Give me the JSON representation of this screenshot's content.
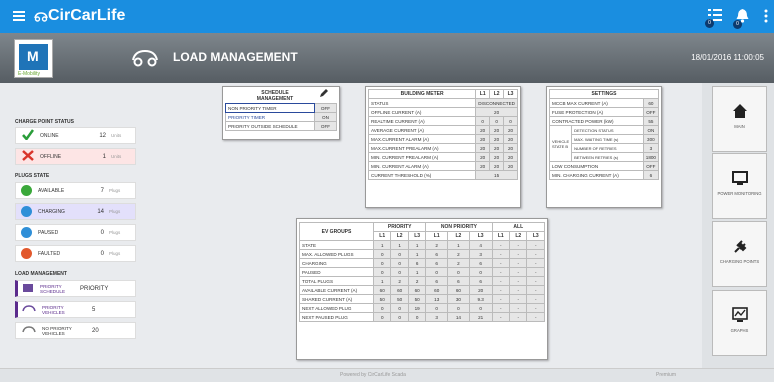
{
  "app": {
    "name": "CirCarLife",
    "notif_count_1": "0",
    "notif_count_2": "0"
  },
  "header": {
    "title": "LOAD MANAGEMENT",
    "datetime": "18/01/2016 11:00:05"
  },
  "logo": {
    "letters": "M",
    "caption": "E-Mobility"
  },
  "charge_point_status": {
    "title": "CHARGE POINT STATUS",
    "rows": [
      {
        "label": "ONLINE",
        "value": "12",
        "unit": "Units"
      },
      {
        "label": "OFFLINE",
        "value": "1",
        "unit": "Units"
      }
    ]
  },
  "plugs_state": {
    "title": "PLUGS STATE",
    "rows": [
      {
        "label": "AVAILABLE",
        "value": "7",
        "unit": "Plugs"
      },
      {
        "label": "CHARGING",
        "value": "14",
        "unit": "Plugs"
      },
      {
        "label": "PAUSED",
        "value": "0",
        "unit": "Plugs"
      },
      {
        "label": "FAULTED",
        "value": "0",
        "unit": "Plugs"
      }
    ]
  },
  "load_management": {
    "title": "LOAD MANAGEMENT",
    "rows": [
      {
        "label": "PRIORITY SCHEDULE",
        "value": "PRIORITY"
      },
      {
        "label": "PRIORITY VEHICLES",
        "value": "5"
      },
      {
        "label": "NO PRIORITY VEHICLES",
        "value": "20"
      }
    ]
  },
  "schedule": {
    "title": "SCHEDULE MANAGEMENT",
    "rows": [
      {
        "label": "NON PRIORITY TIMER",
        "value": "OFF"
      },
      {
        "label": "PRIORITY TIMER",
        "value": "ON"
      },
      {
        "label": "PRIORITY OUTSIDE SCHEDULE",
        "value": "OFF"
      }
    ]
  },
  "building_meter": {
    "title": "BUILDING METER",
    "phases": [
      "L1",
      "L2",
      "L3"
    ],
    "status_label": "STATUS",
    "status_value": "DISCONNECTED",
    "offline_label": "OFFLINE CURRENT (A)",
    "offline_value": "20",
    "rows": [
      {
        "label": "REALTIME CURRENT (A)",
        "values": [
          "0",
          "0",
          "0"
        ]
      },
      {
        "label": "AVERAGE CURRENT (A)",
        "values": [
          "20",
          "20",
          "20"
        ]
      },
      {
        "label": "MAX.CURRENT ALARM (A)",
        "values": [
          "20",
          "20",
          "20"
        ]
      },
      {
        "label": "MAX.CURRENT PREALARM (A)",
        "values": [
          "20",
          "20",
          "20"
        ]
      },
      {
        "label": "MIN. CURRENT PREALARM (A)",
        "values": [
          "20",
          "20",
          "20"
        ]
      },
      {
        "label": "MIN. CURRENT ALARM (A)",
        "values": [
          "20",
          "20",
          "20"
        ]
      }
    ],
    "threshold_label": "CURRENT THRESHOLD (%)",
    "threshold_value": "15"
  },
  "settings": {
    "title": "SETTINGS",
    "mccb_label": "MCCB MAX CURRENT (A)",
    "mccb_value": "60",
    "fuse_label": "FUSE PROTECTION (A)",
    "fuse_value": "OFF",
    "contracted_label": "CONTRACTED POWER (kW)",
    "contracted_value": "55",
    "vehicle_state_label": "VEHICLE STATE B",
    "vehicle_rows": [
      {
        "label": "DETECTION STATUS",
        "value": "ON"
      },
      {
        "label": "MAX. WAITING TIME (s)",
        "value": "300"
      },
      {
        "label": "NUMBER OF RETRIES",
        "value": "3"
      },
      {
        "label": "BETWEEN RETRIES (s)",
        "value": "1800"
      }
    ],
    "low_label": "LOW CONSUMPTION",
    "low_value": "OFF",
    "min_label": "MIN. CHARGING CURRENT (A)",
    "min_value": "6"
  },
  "ev_groups": {
    "title": "EV GROUPS",
    "groups": [
      "PRIORITY",
      "NON PRIORITY",
      "ALL"
    ],
    "phases": [
      "L1",
      "L2",
      "L3",
      "L1",
      "L2",
      "L3",
      "L1",
      "L2",
      "L3"
    ],
    "rows": [
      {
        "label": "STATE",
        "values": [
          "1",
          "1",
          "1",
          "2",
          "1",
          "4",
          "-",
          "-",
          "-"
        ]
      },
      {
        "label": "MAX. ALLOWED PLUGS",
        "values": [
          "0",
          "0",
          "1",
          "6",
          "2",
          "3",
          "-",
          "-",
          "-"
        ]
      },
      {
        "label": "CHARGING",
        "values": [
          "0",
          "0",
          "6",
          "6",
          "2",
          "6",
          "-",
          "-",
          "-"
        ]
      },
      {
        "label": "PAUSED",
        "values": [
          "0",
          "0",
          "1",
          "0",
          "0",
          "0",
          "-",
          "-",
          "-"
        ]
      },
      {
        "label": "TOTAL PLUGS",
        "values": [
          "1",
          "2",
          "2",
          "6",
          "6",
          "6",
          "-",
          "-",
          "-"
        ]
      },
      {
        "label": "AVAILABLE CURRENT (A)",
        "values": [
          "60",
          "60",
          "60",
          "60",
          "60",
          "20",
          "-",
          "-",
          "-"
        ]
      },
      {
        "label": "SHARED CURRENT (A)",
        "values": [
          "50",
          "50",
          "50",
          "13",
          "30",
          "9.3",
          "-",
          "-",
          "-"
        ]
      },
      {
        "label": "NEXT ALLOWED PLUG",
        "values": [
          "0",
          "0",
          "19",
          "0",
          "0",
          "0",
          "-",
          "-",
          "-"
        ]
      },
      {
        "label": "NEXT PAUSED PLUG",
        "values": [
          "0",
          "0",
          "0",
          "3",
          "14",
          "21",
          "-",
          "-",
          "-"
        ]
      }
    ]
  },
  "sidebar": {
    "items": [
      {
        "label": "MAIN"
      },
      {
        "label": "POWER MONITORING"
      },
      {
        "label": "CHARGING POINTS"
      },
      {
        "label": "GRAPHS"
      }
    ]
  },
  "footer": {
    "powered": "Powered by CirCarLife Scada",
    "brand": "Premium"
  },
  "colors": {
    "topbar": "#1a8ee0",
    "online": "#2a9d3a",
    "offline": "#d9342b",
    "charging_row": "#e3e0fb",
    "offline_row": "#fde5e5"
  }
}
